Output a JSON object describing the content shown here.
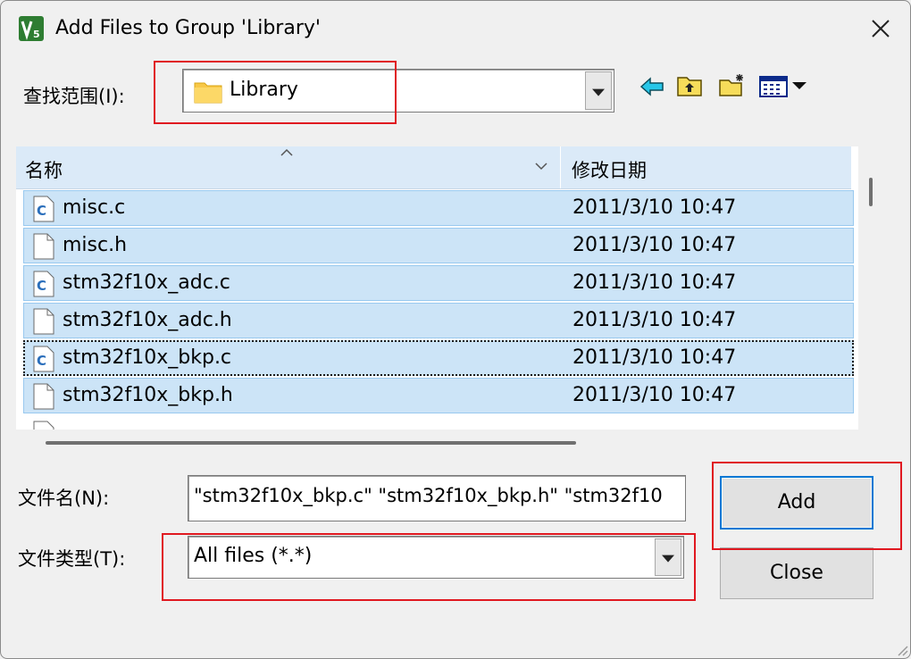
{
  "window": {
    "title": "Add Files to Group 'Library'",
    "app_icon": "keil-uvision-icon",
    "close_icon": "close-icon"
  },
  "look_in": {
    "label": "查找范围(I):",
    "value": "Library",
    "icon": "folder-icon"
  },
  "toolbar": {
    "icons": [
      "back-arrow-icon",
      "up-one-level-icon",
      "new-folder-icon",
      "view-menu-icon"
    ]
  },
  "file_list": {
    "columns": [
      "名称",
      "修改日期"
    ],
    "rows": [
      {
        "name": "misc.c",
        "date": "2011/3/10 10:47",
        "type": "c-file-icon"
      },
      {
        "name": "misc.h",
        "date": "2011/3/10 10:47",
        "type": "h-file-icon"
      },
      {
        "name": "stm32f10x_adc.c",
        "date": "2011/3/10 10:47",
        "type": "c-file-icon"
      },
      {
        "name": "stm32f10x_adc.h",
        "date": "2011/3/10 10:47",
        "type": "h-file-icon"
      },
      {
        "name": "stm32f10x_bkp.c",
        "date": "2011/3/10 10:47",
        "type": "c-file-icon"
      },
      {
        "name": "stm32f10x_bkp.h",
        "date": "2011/3/10 10:47",
        "type": "h-file-icon"
      }
    ]
  },
  "file_name": {
    "label": "文件名(N):",
    "value": "\"stm32f10x_bkp.c\" \"stm32f10x_bkp.h\" \"stm32f10"
  },
  "file_type": {
    "label": "文件类型(T):",
    "value": "All files (*.*)"
  },
  "buttons": {
    "add": "Add",
    "close": "Close"
  },
  "colors": {
    "selection": "#cce4f7",
    "selection_border": "#99c9ef",
    "header": "#dbeaf8",
    "highlight_box": "#e01820",
    "default_button_border": "#0078d4"
  }
}
